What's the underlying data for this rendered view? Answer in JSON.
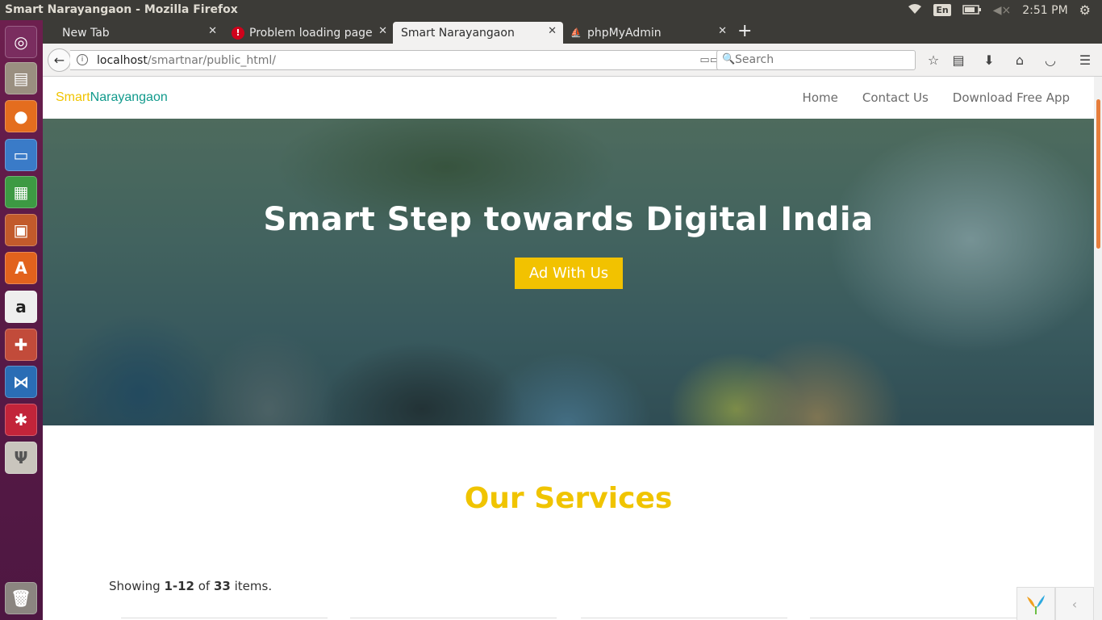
{
  "window": {
    "title": "Smart Narayangaon - Mozilla Firefox"
  },
  "tray": {
    "lang": "En",
    "clock": "2:51 PM"
  },
  "tabs": [
    {
      "label": "New Tab",
      "icon": "none"
    },
    {
      "label": "Problem loading page",
      "icon": "error-icon"
    },
    {
      "label": "Smart Narayangaon",
      "icon": "none",
      "active": true
    },
    {
      "label": "phpMyAdmin",
      "icon": "phpmyadmin-icon"
    }
  ],
  "urlbar": {
    "host": "localhost",
    "path": "/smartnar/public_html/"
  },
  "search": {
    "placeholder": "Search"
  },
  "site": {
    "brand_part1": "Smart",
    "brand_part2": "Narayangaon",
    "menu": [
      "Home",
      "Contact Us",
      "Download Free App"
    ],
    "hero_title": "Smart Step towards Digital India",
    "hero_button": "Ad With Us",
    "services_title": "Our Services",
    "summary": {
      "prefix": "Showing ",
      "range": "1-12",
      "middle": " of ",
      "total": "33",
      "suffix": " items."
    }
  },
  "colors": {
    "brand_yellow": "#f0c400",
    "brand_teal": "#119a8c",
    "panel": "#3c3b37",
    "launcher": "#5a1a47"
  }
}
